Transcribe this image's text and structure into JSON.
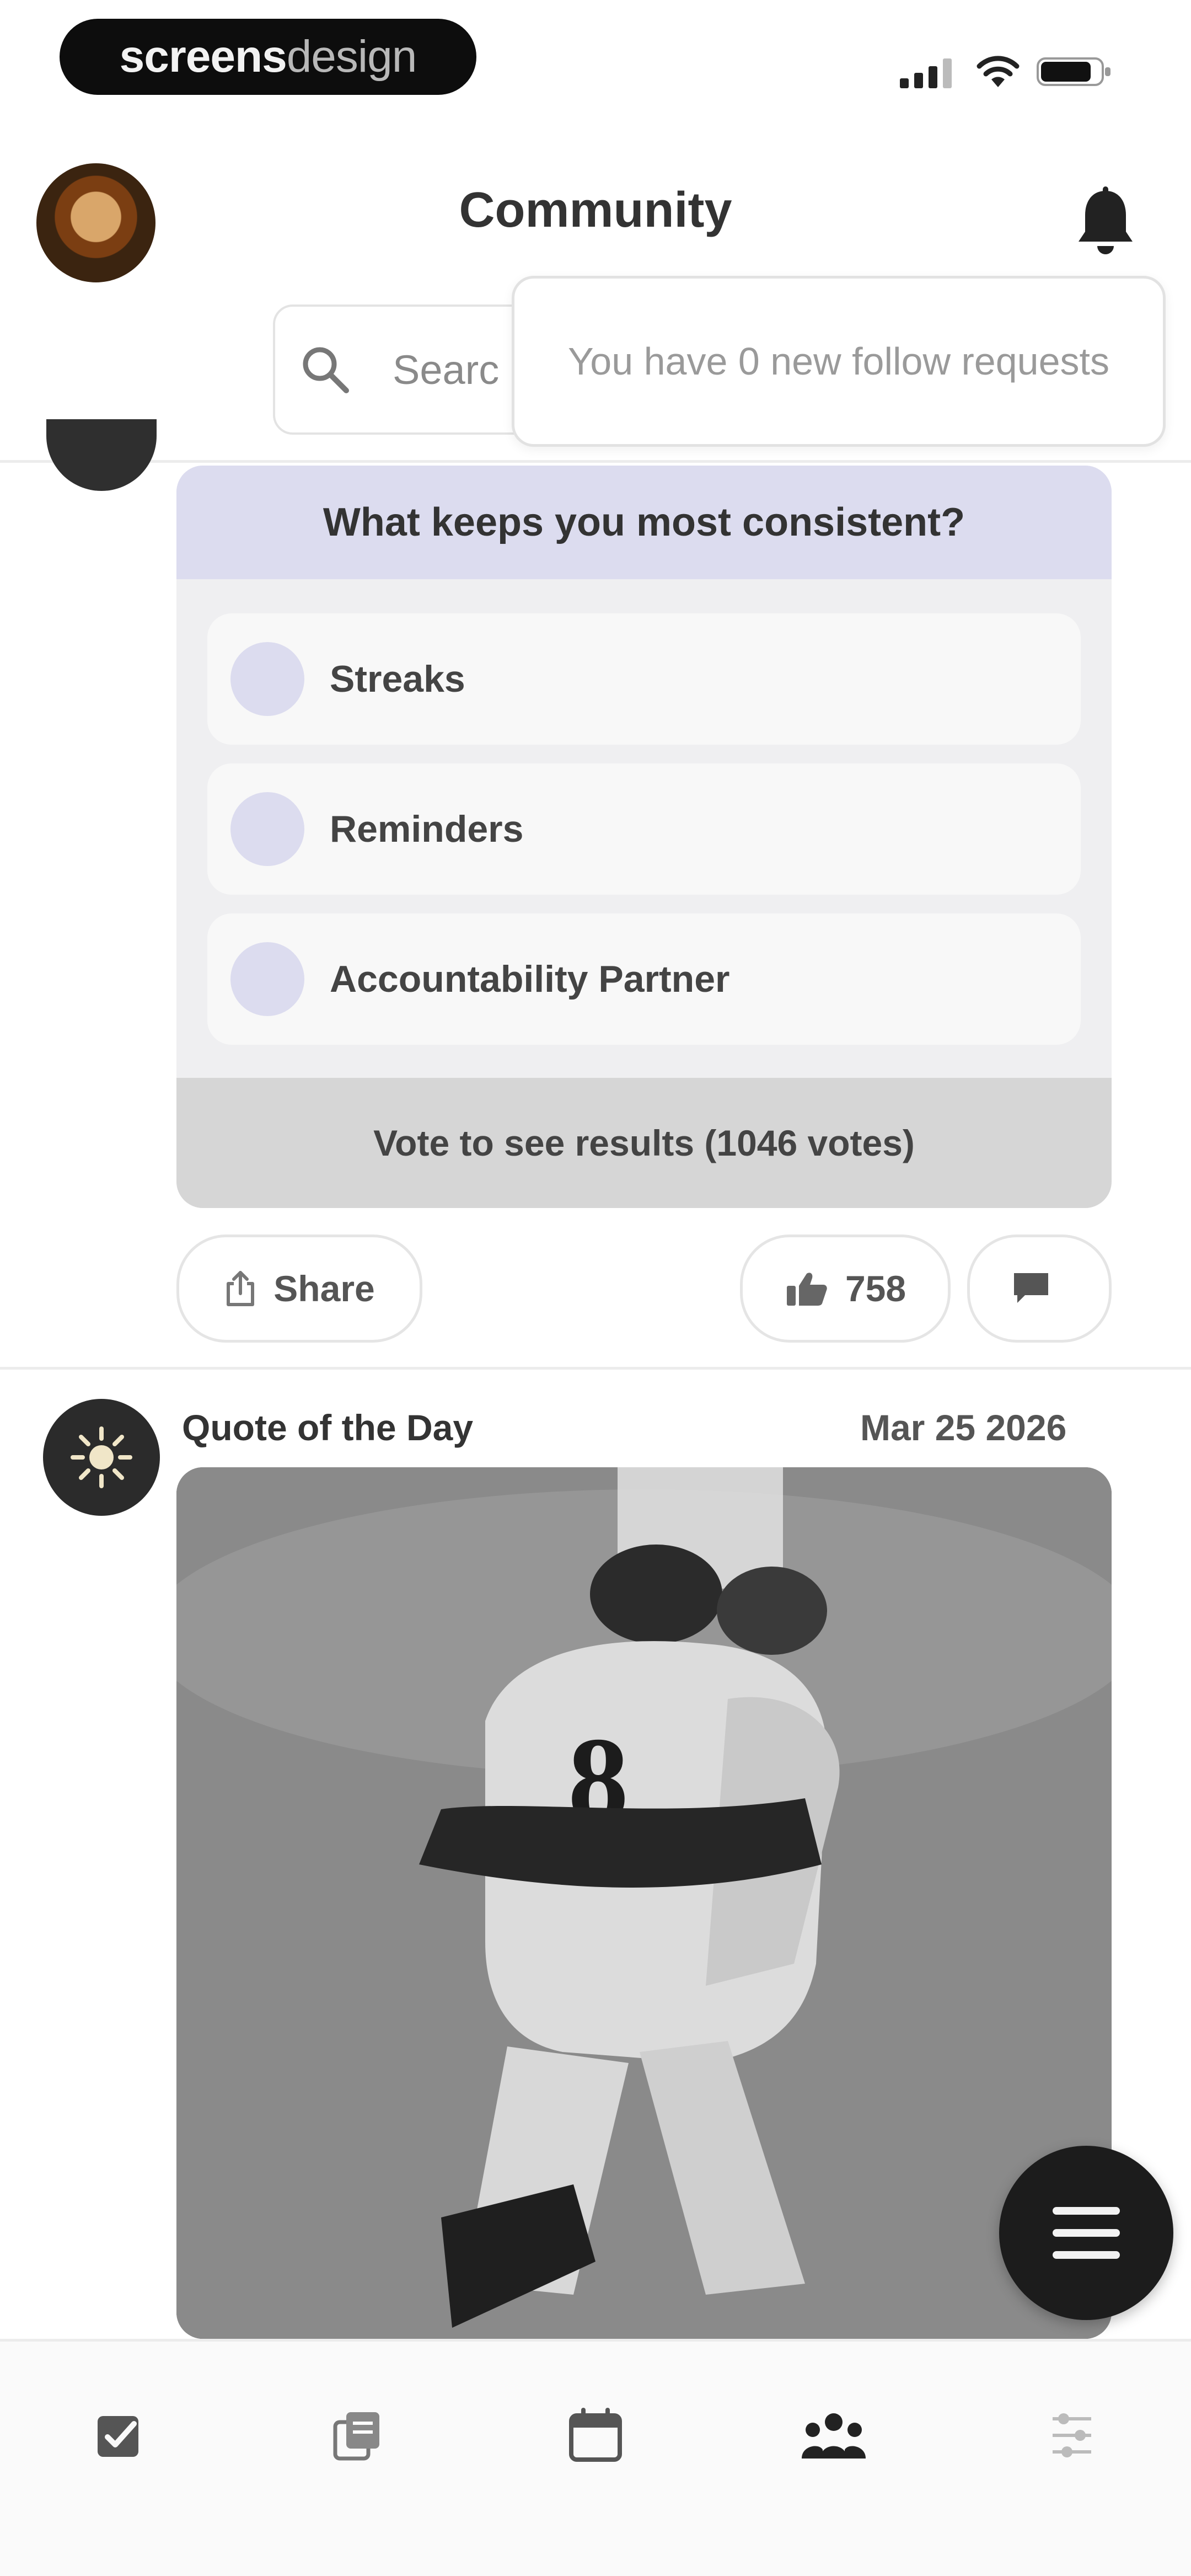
{
  "status_bar": {
    "brand_primary": "screens",
    "brand_secondary": "design",
    "icons": [
      "cellular-signal-icon",
      "wifi-icon",
      "battery-icon"
    ]
  },
  "header": {
    "title": "Community",
    "avatar": "profile-avatar",
    "bell": "bell-icon"
  },
  "search": {
    "placeholder_visible": "Searc"
  },
  "tooltip": {
    "text": "You have 0 new follow requests"
  },
  "poll": {
    "question": "What keeps you most consistent?",
    "options": [
      {
        "label": "Streaks"
      },
      {
        "label": "Reminders"
      },
      {
        "label": "Accountability Partner"
      }
    ],
    "footer": "Vote to see results (1046 votes)",
    "share_label": "Share",
    "like_count": "758"
  },
  "quote_post": {
    "title": "Quote of the Day",
    "date": "Mar 25 2026",
    "image": "baseball-celebration-photo"
  },
  "tabs": [
    {
      "icon": "checkbox-icon"
    },
    {
      "icon": "journal-icon"
    },
    {
      "icon": "calendar-icon"
    },
    {
      "icon": "community-icon",
      "active": true
    },
    {
      "icon": "settings-sliders-icon"
    }
  ],
  "colors": {
    "poll_accent": "#dcdcef",
    "card_bg": "#efeff1",
    "dark": "#1c1c1c"
  }
}
